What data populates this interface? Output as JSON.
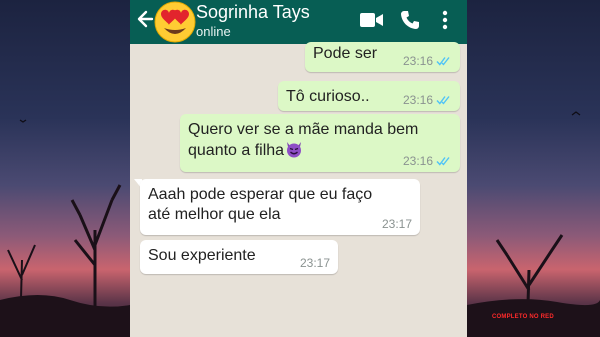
{
  "header": {
    "contact_name": "Sogrinha Tays",
    "status": "online",
    "bg_color": "#075e54"
  },
  "messages": [
    {
      "direction": "out",
      "text": "Pode ser",
      "time": "23:16",
      "ticks": "read"
    },
    {
      "direction": "out",
      "text": "Tô curioso..",
      "time": "23:16",
      "ticks": "read"
    },
    {
      "direction": "out",
      "text": "Quero ver se a mãe manda bem\nquanto a filha",
      "emoji": "smiling-imp",
      "time": "23:16",
      "ticks": "read"
    },
    {
      "direction": "in",
      "text": "Aaah pode esperar que eu faço\naté melhor que ela",
      "time": "23:17"
    },
    {
      "direction": "in",
      "text": "Sou experiente",
      "time": "23:17"
    }
  ],
  "icons": {
    "back": "arrow-left-icon",
    "avatar": "heart-eyes-emoji-icon",
    "video": "video-camera-icon",
    "call": "phone-icon",
    "menu": "more-vertical-icon",
    "read_receipt": "double-check-icon"
  },
  "colors": {
    "outgoing_bubble": "#dcf8c6",
    "incoming_bubble": "#ffffff",
    "chat_background": "#e7e1d8",
    "read_ticks": "#4fc3f7"
  },
  "watermark": {
    "text": "COMPLETO NO RED"
  }
}
